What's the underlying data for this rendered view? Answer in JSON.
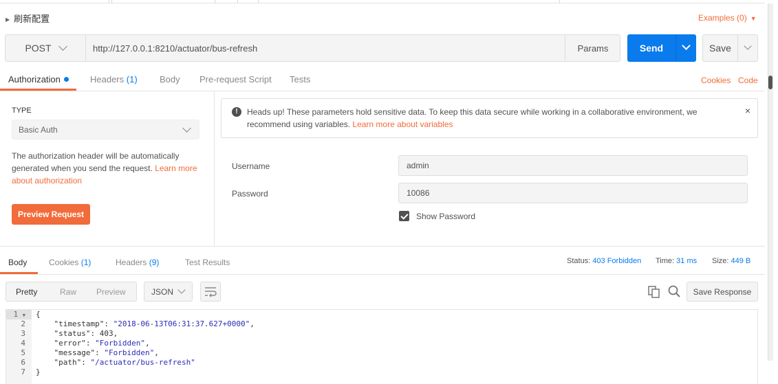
{
  "request": {
    "title": "刷新配置",
    "examples_label": "Examples (0)",
    "method": "POST",
    "url": "http://127.0.0.1:8210/actuator/bus-refresh",
    "params_label": "Params",
    "send_label": "Send",
    "save_label": "Save"
  },
  "req_tabs": [
    {
      "label": "Authorization"
    },
    {
      "label": "Headers",
      "count": "(1)"
    },
    {
      "label": "Body"
    },
    {
      "label": "Pre-request Script"
    },
    {
      "label": "Tests"
    }
  ],
  "req_links": {
    "cookies": "Cookies",
    "code": "Code"
  },
  "auth": {
    "type_label": "TYPE",
    "type_value": "Basic Auth",
    "description": "The authorization header will be automatically generated when you send the request. ",
    "learn_link": "Learn more about authorization",
    "preview_button": "Preview Request"
  },
  "alert": {
    "text": "Heads up! These parameters hold sensitive data. To keep this data secure while working in a collaborative environment, we recommend using variables. ",
    "link": "Learn more about variables",
    "close": "×"
  },
  "fields": {
    "username_label": "Username",
    "username_value": "admin",
    "password_label": "Password",
    "password_value": "10086",
    "show_password_label": "Show Password"
  },
  "resp_tabs": [
    {
      "label": "Body"
    },
    {
      "label": "Cookies",
      "count": "(1)"
    },
    {
      "label": "Headers",
      "count": "(9)"
    },
    {
      "label": "Test Results"
    }
  ],
  "status": {
    "status_label": "Status:",
    "status_value": "403 Forbidden",
    "time_label": "Time:",
    "time_value": "31 ms",
    "size_label": "Size:",
    "size_value": "449 B"
  },
  "view": {
    "modes": [
      "Pretty",
      "Raw",
      "Preview"
    ],
    "format": "JSON",
    "save_response": "Save Response"
  },
  "code_lines": [
    {
      "num": "1",
      "text": "{"
    },
    {
      "num": "2",
      "key": "\"timestamp\"",
      "val": "\"2018-06-13T06:31:37.627+0000\"",
      "tail": ","
    },
    {
      "num": "3",
      "key": "\"status\"",
      "val": "403",
      "tail": ","
    },
    {
      "num": "4",
      "key": "\"error\"",
      "val": "\"Forbidden\"",
      "tail": ","
    },
    {
      "num": "5",
      "key": "\"message\"",
      "val": "\"Forbidden\"",
      "tail": ","
    },
    {
      "num": "6",
      "key": "\"path\"",
      "val": "\"/actuator/bus-refresh\"",
      "tail": ""
    },
    {
      "num": "7",
      "text": "}"
    }
  ],
  "colors": {
    "accent": "#f26b3a",
    "primary": "#097bed",
    "string": "#2c2cb7"
  }
}
